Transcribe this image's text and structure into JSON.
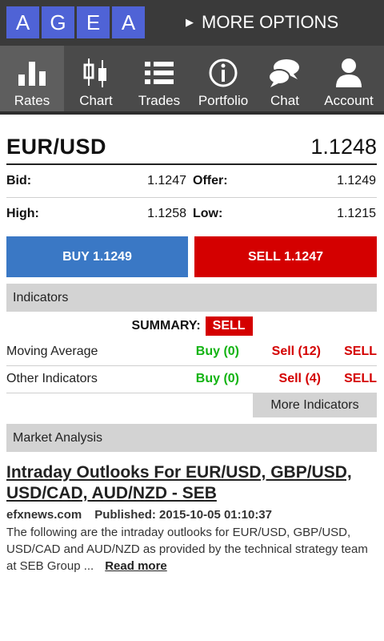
{
  "colors": {
    "topbar_bg": "#3a3a3a",
    "nav_bg": "#4a4a4a",
    "logo_tile": "#4f63d6",
    "buy_blue": "#3a78c5",
    "sell_red": "#d40000",
    "buy_green": "#12b312",
    "section_gray": "#d3d3d3"
  },
  "header": {
    "logo_letters": [
      "A",
      "G",
      "E",
      "A"
    ],
    "more_options": "MORE OPTIONS",
    "more_options_icon": "triangle-right-icon"
  },
  "nav": {
    "active": "Rates",
    "items": [
      {
        "label": "Rates",
        "icon": "bar-chart-icon"
      },
      {
        "label": "Chart",
        "icon": "candlestick-icon"
      },
      {
        "label": "Trades",
        "icon": "list-icon"
      },
      {
        "label": "Portfolio",
        "icon": "info-icon"
      },
      {
        "label": "Chat",
        "icon": "chat-bubbles-icon"
      },
      {
        "label": "Account",
        "icon": "user-icon"
      }
    ]
  },
  "quote": {
    "pair": "EUR/USD",
    "price": "1.1248",
    "bid_label": "Bid:",
    "bid": "1.1247",
    "offer_label": "Offer:",
    "offer": "1.1249",
    "high_label": "High:",
    "high": "1.1258",
    "low_label": "Low:",
    "low": "1.1215"
  },
  "actions": {
    "buy": "BUY 1.1249",
    "sell": "SELL 1.1247"
  },
  "indicators": {
    "header": "Indicators",
    "summary_label": "SUMMARY:",
    "summary_value": "SELL",
    "rows": [
      {
        "name": "Moving Average",
        "buy": "Buy (0)",
        "sell": "Sell (12)",
        "verdict": "SELL"
      },
      {
        "name": "Other Indicators",
        "buy": "Buy (0)",
        "sell": "Sell (4)",
        "verdict": "SELL"
      }
    ],
    "more_button": "More Indicators"
  },
  "analysis": {
    "header": "Market Analysis",
    "article": {
      "title": "Intraday Outlooks For EUR/USD, GBP/USD, USD/CAD, AUD/NZD - SEB",
      "source": "efxnews.com",
      "published": "Published: 2015-10-05 01:10:37",
      "excerpt": "The following are the intraday outlooks for EUR/USD, GBP/USD, USD/CAD and AUD/NZD as provided by the technical strategy team at SEB Group ...",
      "read_more": "Read more"
    }
  }
}
